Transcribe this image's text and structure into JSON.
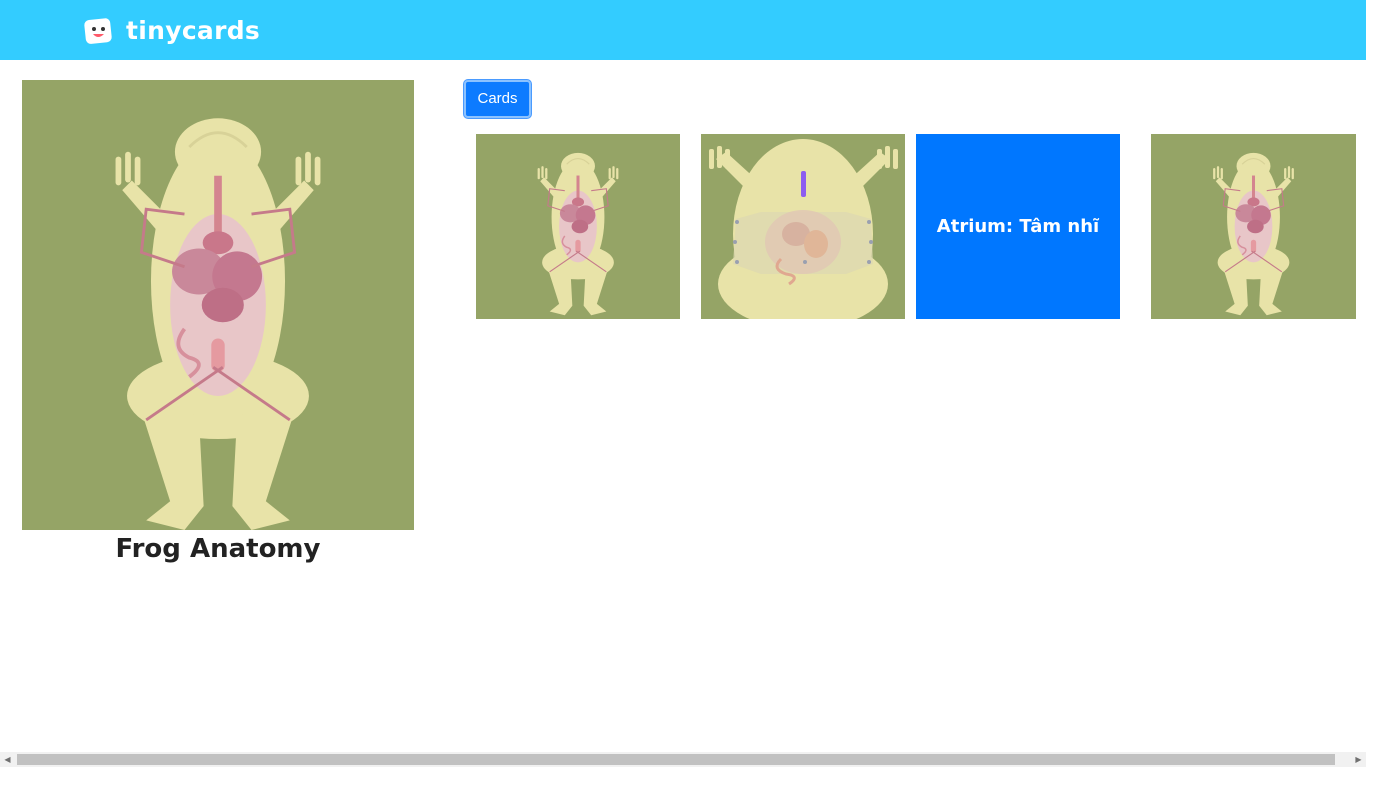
{
  "header": {
    "brand": "tinycards",
    "colors": {
      "bar": "#33ccff"
    }
  },
  "deck": {
    "title": "Frog Anatomy",
    "cover_icon": "frog-anatomy-illustration"
  },
  "tabs": {
    "cards_label": "Cards"
  },
  "cards": [
    {
      "type": "image",
      "icon": "frog-anatomy-illustration"
    },
    {
      "type": "image",
      "icon": "frog-dissection-illustration"
    },
    {
      "type": "text",
      "text": "Atrium: Tâm nhĩ"
    },
    {
      "type": "image",
      "icon": "frog-anatomy-illustration"
    }
  ],
  "colors": {
    "accent": "#0077ff",
    "card_background": "#95a466"
  }
}
